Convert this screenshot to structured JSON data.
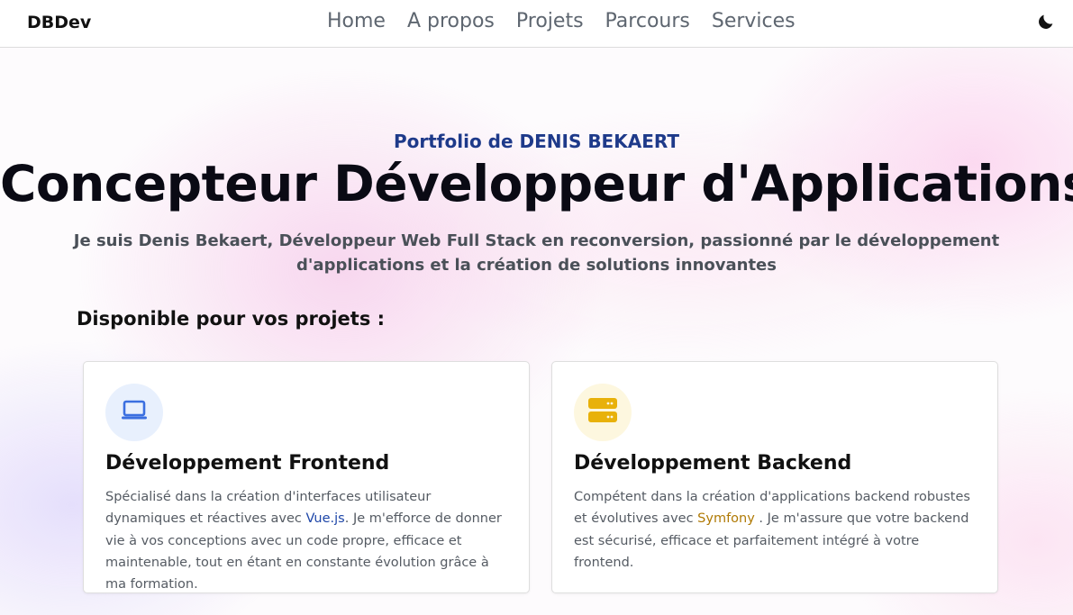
{
  "navbar": {
    "brand": "DBDev",
    "links": [
      {
        "label": "Home"
      },
      {
        "label": "A propos"
      },
      {
        "label": "Projets"
      },
      {
        "label": "Parcours"
      },
      {
        "label": "Services"
      }
    ],
    "theme_icon": "moon-icon"
  },
  "hero": {
    "kicker": "Portfolio de DENIS BEKAERT",
    "title": "Concepteur Développeur d'Applications",
    "subtitle": "Je suis Denis Bekaert, Développeur Web Full Stack en reconversion, passionné par le développement d'applications et la création de solutions innovantes"
  },
  "services": {
    "title": "Disponible pour vos projets :",
    "cards": [
      {
        "icon": "laptop-icon",
        "title": "Développement Frontend",
        "text_before": "Spécialisé dans la création d'interfaces utilisateur dynamiques et réactives avec ",
        "highlight": "Vue.js",
        "text_after": ". Je m'efforce de donner vie à vos conceptions avec un code propre, efficace et maintenable, tout en étant en constante évolution grâce à ma formation."
      },
      {
        "icon": "server-icon",
        "title": "Développement Backend",
        "text_before": "Compétent dans la création d'applications backend robustes et évolutives avec ",
        "highlight": "Symfony",
        "text_after": " . Je m'assure que votre backend est sécurisé, efficace et parfaitement intégré à votre frontend."
      }
    ]
  },
  "colors": {
    "accent_blue": "#1e3a8a",
    "vue_link": "#1e46a8",
    "symfony_link": "#b07a05",
    "laptop_icon": "#3b6fe0",
    "server_icon": "#e8b10a"
  }
}
